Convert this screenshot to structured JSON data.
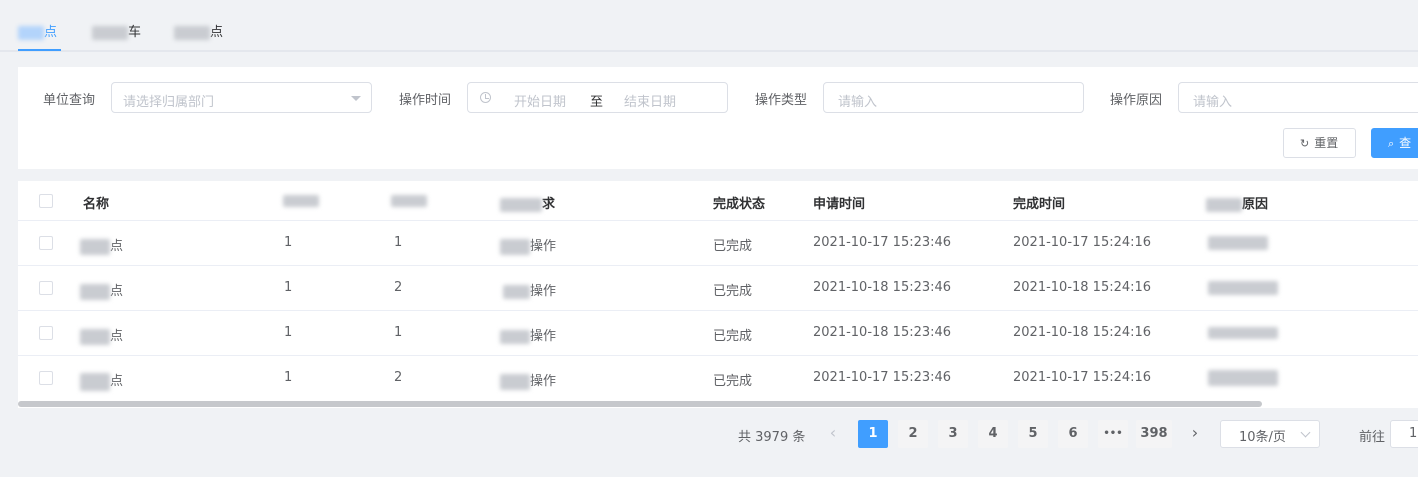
{
  "tabs": [
    {
      "label": "点"
    },
    {
      "label": "车"
    },
    {
      "label": "点"
    }
  ],
  "filter": {
    "unit_label": "单位查询",
    "unit_placeholder": "请选择归属部门",
    "time_label": "操作时间",
    "start_placeholder": "开始日期",
    "range_sep": "至",
    "end_placeholder": "结束日期",
    "type_label": "操作类型",
    "type_placeholder": "请输入",
    "reason_label": "操作原因",
    "reason_placeholder": "请输入",
    "reset_label": "重置",
    "query_label": "查"
  },
  "table": {
    "headers": {
      "name": "名称",
      "request": "求",
      "status": "完成状态",
      "apply_time": "申请时间",
      "finish_time": "完成时间",
      "reason": "原因"
    },
    "rows": [
      {
        "name": "点",
        "c1": "1",
        "c2": "1",
        "op": "操作",
        "status": "已完成",
        "apply": "2021-10-17 15:23:46",
        "finish": "2021-10-17 15:24:16"
      },
      {
        "name": "点",
        "c1": "1",
        "c2": "2",
        "op": "操作",
        "status": "已完成",
        "apply": "2021-10-18 15:23:46",
        "finish": "2021-10-18 15:24:16"
      },
      {
        "name": "点",
        "c1": "1",
        "c2": "1",
        "op": "操作",
        "status": "已完成",
        "apply": "2021-10-18 15:23:46",
        "finish": "2021-10-18 15:24:16"
      },
      {
        "name": "点",
        "c1": "1",
        "c2": "2",
        "op": "操作",
        "status": "已完成",
        "apply": "2021-10-17 15:23:46",
        "finish": "2021-10-17 15:24:16"
      }
    ]
  },
  "pagination": {
    "total": "共 3979 条",
    "pages": [
      "1",
      "2",
      "3",
      "4",
      "5",
      "6",
      "•••",
      "398"
    ],
    "page_size": "10条/页",
    "goto_label": "前往",
    "goto_value": "1",
    "prev": "‹",
    "next": "›"
  },
  "colors": {
    "accent": "#409eff"
  }
}
